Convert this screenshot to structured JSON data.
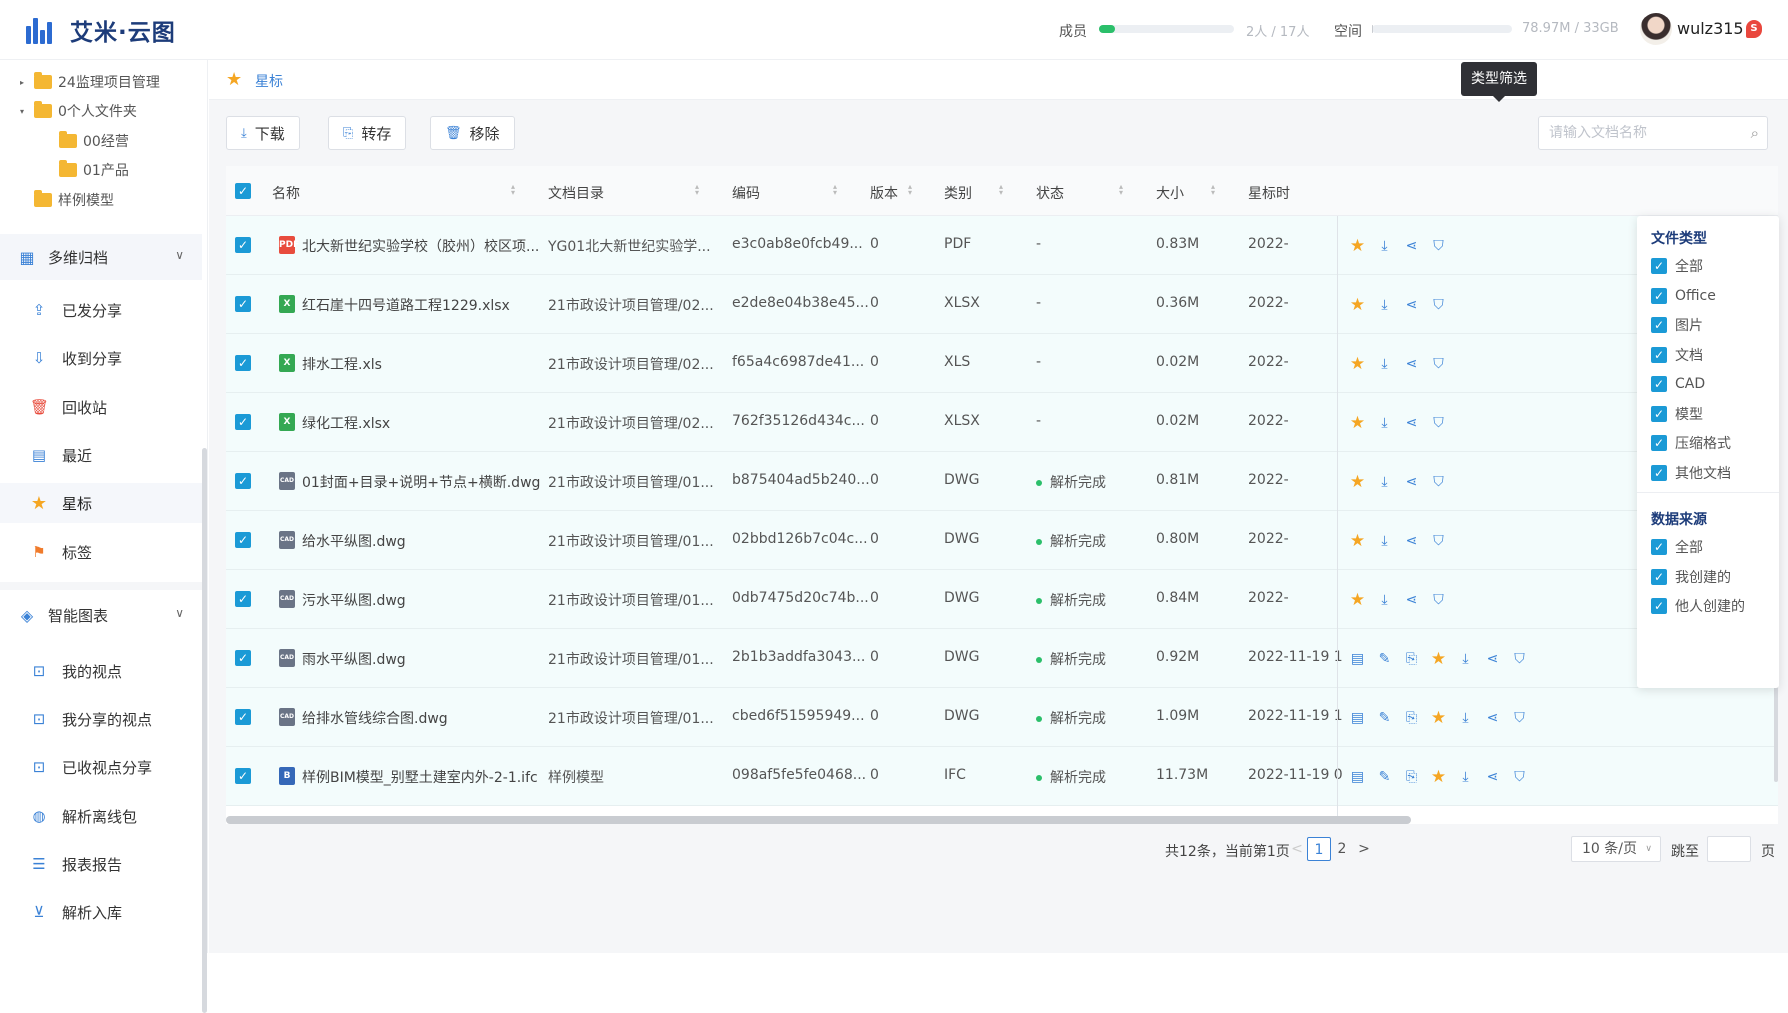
{
  "header": {
    "app_name": "艾米·云图",
    "members_label": "成员",
    "members_value": "2人 / 17人",
    "members_progress": 0.12,
    "space_label": "空间",
    "space_value": "78.97M / 33GB",
    "space_progress": 0.003,
    "username": "wulz315",
    "badge": "S"
  },
  "sidebar": {
    "tree": [
      {
        "label": "24监理项目管理",
        "caret": "▸"
      },
      {
        "label": "0个人文件夹",
        "caret": "▾"
      },
      {
        "label": "00经营",
        "caret": ""
      },
      {
        "label": "01产品",
        "caret": ""
      },
      {
        "label": "样例模型",
        "caret": ""
      }
    ],
    "group1": {
      "label": "多维归档"
    },
    "items1": [
      {
        "label": "已发分享",
        "icon": "share-out-icon"
      },
      {
        "label": "收到分享",
        "icon": "share-in-icon"
      },
      {
        "label": "回收站",
        "icon": "trash-icon"
      },
      {
        "label": "最近",
        "icon": "recent-icon"
      },
      {
        "label": "星标",
        "icon": "star-icon"
      },
      {
        "label": "标签",
        "icon": "tag-icon"
      }
    ],
    "group2": {
      "label": "智能图表"
    },
    "items2": [
      {
        "label": "我的视点",
        "icon": "viewpoint-icon"
      },
      {
        "label": "我分享的视点",
        "icon": "viewpoint-icon"
      },
      {
        "label": "已收视点分享",
        "icon": "viewpoint-icon"
      },
      {
        "label": "解析离线包",
        "icon": "globe-icon"
      },
      {
        "label": "报表报告",
        "icon": "report-icon"
      },
      {
        "label": "解析入库",
        "icon": "import-icon"
      }
    ]
  },
  "breadcrumb": {
    "label": "星标"
  },
  "toolbar": {
    "download": "下载",
    "transfer": "转存",
    "remove": "移除",
    "search_placeholder": "请输入文档名称",
    "tooltip": "类型筛选"
  },
  "table": {
    "columns": [
      "名称",
      "文档目录",
      "编码",
      "版本",
      "类别",
      "状态",
      "大小",
      "星标时"
    ],
    "rows": [
      {
        "name": "北大新世纪实验学校（胶州）校区项...",
        "dir": "YG01北大新世纪实验学...",
        "code": "e3c0ab8e0fcb49...",
        "ver": "0",
        "type": "PDF",
        "status": "-",
        "parsed": false,
        "size": "0.83M",
        "time": "2022-",
        "icon": "PDF",
        "kind": "pdf"
      },
      {
        "name": "红石崖十四号道路工程1229.xlsx",
        "dir": "21市政设计项目管理/02...",
        "code": "e2de8e04b38e45...",
        "ver": "0",
        "type": "XLSX",
        "status": "-",
        "parsed": false,
        "size": "0.36M",
        "time": "2022-",
        "icon": "X",
        "kind": "xls"
      },
      {
        "name": "排水工程.xls",
        "dir": "21市政设计项目管理/02...",
        "code": "f65a4c6987de41...",
        "ver": "0",
        "type": "XLS",
        "status": "-",
        "parsed": false,
        "size": "0.02M",
        "time": "2022-",
        "icon": "X",
        "kind": "xls"
      },
      {
        "name": "绿化工程.xlsx",
        "dir": "21市政设计项目管理/02...",
        "code": "762f35126d434c...",
        "ver": "0",
        "type": "XLSX",
        "status": "-",
        "parsed": false,
        "size": "0.02M",
        "time": "2022-",
        "icon": "X",
        "kind": "xls"
      },
      {
        "name": "01封面+目录+说明+节点+横断.dwg",
        "dir": "21市政设计项目管理/01...",
        "code": "b875404ad5b240...",
        "ver": "0",
        "type": "DWG",
        "status": "解析完成",
        "parsed": true,
        "size": "0.81M",
        "time": "2022-",
        "icon": "CAD",
        "kind": "dwg"
      },
      {
        "name": "给水平纵图.dwg",
        "dir": "21市政设计项目管理/01...",
        "code": "02bbd126b7c04c...",
        "ver": "0",
        "type": "DWG",
        "status": "解析完成",
        "parsed": true,
        "size": "0.80M",
        "time": "2022-",
        "icon": "CAD",
        "kind": "dwg"
      },
      {
        "name": "污水平纵图.dwg",
        "dir": "21市政设计项目管理/01...",
        "code": "0db7475d20c74b...",
        "ver": "0",
        "type": "DWG",
        "status": "解析完成",
        "parsed": true,
        "size": "0.84M",
        "time": "2022-",
        "icon": "CAD",
        "kind": "dwg"
      },
      {
        "name": "雨水平纵图.dwg",
        "dir": "21市政设计项目管理/01...",
        "code": "2b1b3addfa3043...",
        "ver": "0",
        "type": "DWG",
        "status": "解析完成",
        "parsed": true,
        "size": "0.92M",
        "time": "2022-11-19 1",
        "icon": "CAD",
        "kind": "dwg"
      },
      {
        "name": "给排水管线综合图.dwg",
        "dir": "21市政设计项目管理/01...",
        "code": "cbed6f51595949...",
        "ver": "0",
        "type": "DWG",
        "status": "解析完成",
        "parsed": true,
        "size": "1.09M",
        "time": "2022-11-19 1",
        "icon": "CAD",
        "kind": "dwg"
      },
      {
        "name": "样例BIM模型_别墅土建室内外-2-1.ifc",
        "dir": "样例模型",
        "code": "098af5fe5fe0468...",
        "ver": "0",
        "type": "IFC",
        "status": "解析完成",
        "parsed": true,
        "size": "11.73M",
        "time": "2022-11-19 0",
        "icon": "B",
        "kind": "ifc"
      }
    ]
  },
  "pagination": {
    "summary": "共12条，当前第1页",
    "prev": "<",
    "pages": [
      "1",
      "2"
    ],
    "next": ">",
    "page_size": "10 条/页",
    "jump_label": "跳至",
    "page_unit": "页"
  },
  "filter": {
    "file_type_title": "文件类型",
    "file_types": [
      "全部",
      "Office",
      "图片",
      "文档",
      "CAD",
      "模型",
      "压缩格式",
      "其他文档"
    ],
    "source_title": "数据来源",
    "sources": [
      "全部",
      "我创建的",
      "他人创建的"
    ]
  },
  "colors": {
    "accent": "#1b9ad6",
    "star": "#f5a623",
    "success": "#2bbf6a"
  }
}
